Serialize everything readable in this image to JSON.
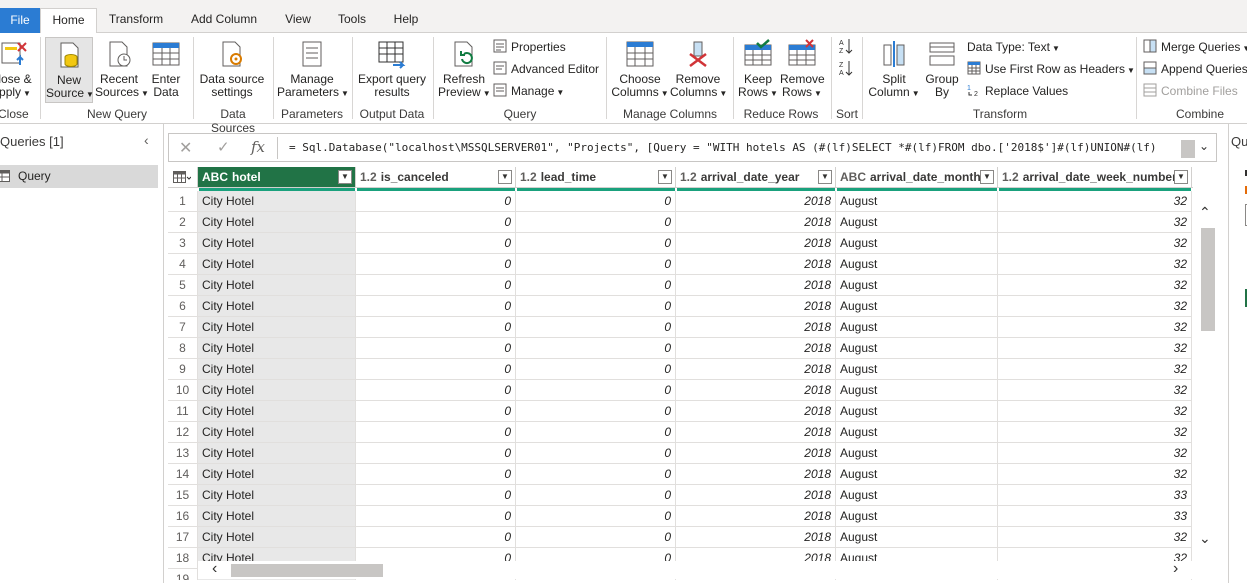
{
  "tabs": [
    "File",
    "Home",
    "Transform",
    "Add Column",
    "View",
    "Tools",
    "Help"
  ],
  "ribbon": {
    "close": {
      "label1": "lose &",
      "label2": "pply",
      "group": "Close"
    },
    "new_query": {
      "new_source": [
        "New",
        "Source"
      ],
      "recent_sources": [
        "Recent",
        "Sources"
      ],
      "enter_data": [
        "Enter",
        "Data"
      ],
      "group": "New Query"
    },
    "data_sources": {
      "button": [
        "Data source",
        "settings"
      ],
      "group": "Data Sources"
    },
    "parameters": {
      "button": [
        "Manage",
        "Parameters"
      ],
      "group": "Parameters"
    },
    "output_data": {
      "button": [
        "Export query",
        "results"
      ],
      "group": "Output Data"
    },
    "query": {
      "refresh": [
        "Refresh",
        "Preview"
      ],
      "properties": "Properties",
      "advanced_editor": "Advanced Editor",
      "manage": "Manage",
      "group": "Query"
    },
    "manage_columns": {
      "choose": [
        "Choose",
        "Columns"
      ],
      "remove": [
        "Remove",
        "Columns"
      ],
      "group": "Manage Columns"
    },
    "reduce_rows": {
      "keep": [
        "Keep",
        "Rows"
      ],
      "remove": [
        "Remove",
        "Rows"
      ],
      "group": "Reduce Rows"
    },
    "sort": {
      "group": "Sort"
    },
    "transform": {
      "split": [
        "Split",
        "Column"
      ],
      "group_by": [
        "Group",
        "By"
      ],
      "data_type": "Data Type: Text",
      "first_row": "Use First Row as Headers",
      "replace": "Replace Values",
      "group": "Transform"
    },
    "combine": {
      "merge": "Merge Queries",
      "append": "Append Queries",
      "combine_files": "Combine Files",
      "group": "Combine"
    }
  },
  "queries_pane": {
    "title": "Queries [1]",
    "items": [
      "Query"
    ]
  },
  "formula": "= Sql.Database(\"localhost\\MSSQLSERVER01\", \"Projects\", [Query = \"WITH hotels AS (#(lf)SELECT *#(lf)FROM dbo.['2018$']#(lf)UNION#(lf)",
  "right_pane": {
    "title": "Qu"
  },
  "grid": {
    "columns": [
      {
        "type": "ABC",
        "name": "hotel"
      },
      {
        "type": "1.2",
        "name": "is_canceled"
      },
      {
        "type": "1.2",
        "name": "lead_time"
      },
      {
        "type": "1.2",
        "name": "arrival_date_year"
      },
      {
        "type": "ABC",
        "name": "arrival_date_month"
      },
      {
        "type": "1.2",
        "name": "arrival_date_week_number"
      },
      {
        "type": "1.2",
        "name": ""
      }
    ],
    "rows": [
      [
        "1",
        "City Hotel",
        "0",
        "0",
        "2018",
        "August",
        "32"
      ],
      [
        "2",
        "City Hotel",
        "0",
        "0",
        "2018",
        "August",
        "32"
      ],
      [
        "3",
        "City Hotel",
        "0",
        "0",
        "2018",
        "August",
        "32"
      ],
      [
        "4",
        "City Hotel",
        "0",
        "0",
        "2018",
        "August",
        "32"
      ],
      [
        "5",
        "City Hotel",
        "0",
        "0",
        "2018",
        "August",
        "32"
      ],
      [
        "6",
        "City Hotel",
        "0",
        "0",
        "2018",
        "August",
        "32"
      ],
      [
        "7",
        "City Hotel",
        "0",
        "0",
        "2018",
        "August",
        "32"
      ],
      [
        "8",
        "City Hotel",
        "0",
        "0",
        "2018",
        "August",
        "32"
      ],
      [
        "9",
        "City Hotel",
        "0",
        "0",
        "2018",
        "August",
        "32"
      ],
      [
        "10",
        "City Hotel",
        "0",
        "0",
        "2018",
        "August",
        "32"
      ],
      [
        "11",
        "City Hotel",
        "0",
        "0",
        "2018",
        "August",
        "32"
      ],
      [
        "12",
        "City Hotel",
        "0",
        "0",
        "2018",
        "August",
        "32"
      ],
      [
        "13",
        "City Hotel",
        "0",
        "0",
        "2018",
        "August",
        "32"
      ],
      [
        "14",
        "City Hotel",
        "0",
        "0",
        "2018",
        "August",
        "32"
      ],
      [
        "15",
        "City Hotel",
        "0",
        "0",
        "2018",
        "August",
        "33"
      ],
      [
        "16",
        "City Hotel",
        "0",
        "0",
        "2018",
        "August",
        "33"
      ],
      [
        "17",
        "City Hotel",
        "0",
        "0",
        "2018",
        "August",
        "32"
      ],
      [
        "18",
        "City Hotel",
        "0",
        "0",
        "2018",
        "August",
        "32"
      ],
      [
        "19",
        "",
        "",
        "",
        "",
        "",
        ""
      ]
    ]
  },
  "colors": {
    "accent": "#217346",
    "file_tab": "#2b7cd3",
    "quality": "#1aa17d"
  }
}
